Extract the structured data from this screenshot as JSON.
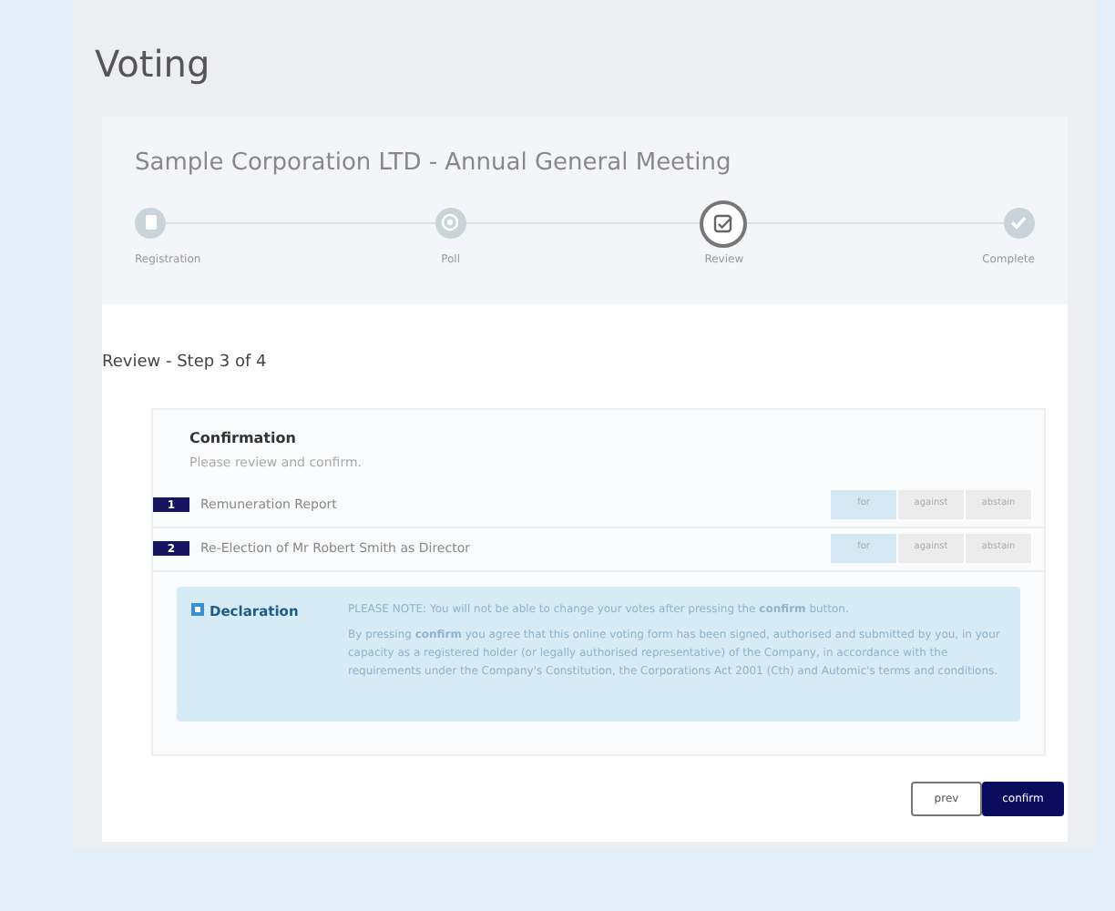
{
  "page_title": "Voting",
  "meeting_title": "Sample Corporation LTD - Annual General Meeting",
  "steps": [
    {
      "label": "Registration",
      "kind": "clipboard",
      "selected": false
    },
    {
      "label": "Poll",
      "kind": "target",
      "selected": false
    },
    {
      "label": "Review",
      "kind": "review",
      "selected": true
    },
    {
      "label": "Complete",
      "kind": "check",
      "selected": false
    }
  ],
  "step_heading": "Review - Step 3 of 4",
  "confirmation": {
    "title": "Confirmation",
    "subtitle": "Please review and confirm."
  },
  "resolutions": [
    {
      "number": "1",
      "title": "Remuneration Report",
      "options": [
        {
          "label": "for",
          "selected": true
        },
        {
          "label": "against",
          "selected": false
        },
        {
          "label": "abstain",
          "selected": false
        }
      ]
    },
    {
      "number": "2",
      "title": "Re-Election of Mr Robert Smith as Director",
      "options": [
        {
          "label": "for",
          "selected": true
        },
        {
          "label": "against",
          "selected": false
        },
        {
          "label": "abstain",
          "selected": false
        }
      ]
    }
  ],
  "declaration": {
    "label": "Declaration",
    "checked": true,
    "note": "PLEASE NOTE: You will not be able to change your votes after pressing the **confirm** button.",
    "text": "By pressing **confirm** you agree that this online voting form has been signed, authorised and submitted by you, in your capacity as a registered holder (or legally authorised representative) of the Company, in accordance with the requirements under the Company's Constitution, the Corporations Act 2001 (Cth) and Automic's terms and conditions."
  },
  "buttons": {
    "prev": "prev",
    "confirm": "confirm"
  }
}
